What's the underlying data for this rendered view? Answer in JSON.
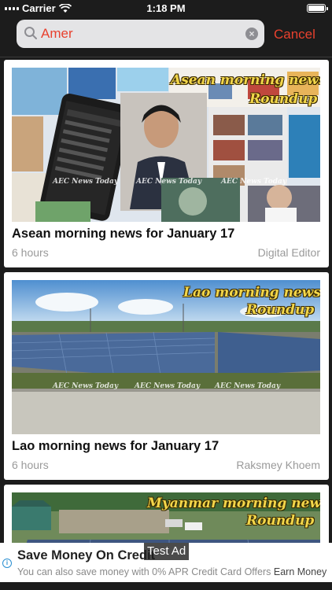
{
  "status_bar": {
    "carrier": "Carrier",
    "time": "1:18 PM"
  },
  "search": {
    "query": "Amer",
    "cancel_label": "Cancel"
  },
  "cards": [
    {
      "overlay_line1": "Asean morning news",
      "overlay_line2": "Roundup",
      "watermark": "AEC News Today",
      "title": "Asean morning news for January 17",
      "time": "6 hours",
      "author": "Digital Editor"
    },
    {
      "overlay_line1": "Lao morning news",
      "overlay_line2": "Roundup",
      "watermark": "AEC News Today",
      "title": "Lao morning news for January 17",
      "time": "6 hours",
      "author": "Raksmey Khoem"
    },
    {
      "overlay_line1": "Myanmar morning news",
      "overlay_line2": "Roundup"
    }
  ],
  "ad": {
    "headline": "Save Money On Credit",
    "badge": "Test Ad",
    "body": "You can also save money with 0% APR Credit Card Offers",
    "link": "Earn Money"
  },
  "colors": {
    "accent": "#e8412e",
    "background": "#1c1c1c",
    "ad_icon": "#2a8fd1"
  }
}
